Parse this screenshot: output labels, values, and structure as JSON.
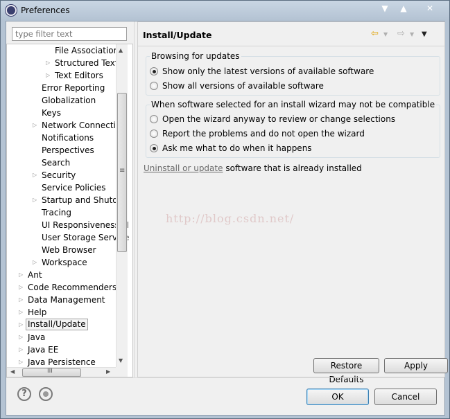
{
  "window": {
    "title": "Preferences",
    "controls": [
      "▼",
      "▲",
      "✕"
    ]
  },
  "filter": {
    "placeholder": "type filter text"
  },
  "tree": {
    "items": [
      {
        "label": "File Associations",
        "indent": 3,
        "arrow": ""
      },
      {
        "label": "Structured Text E",
        "indent": 3,
        "arrow": "▷"
      },
      {
        "label": "Text Editors",
        "indent": 3,
        "arrow": "▷"
      },
      {
        "label": "Error Reporting",
        "indent": 2,
        "arrow": ""
      },
      {
        "label": "Globalization",
        "indent": 2,
        "arrow": ""
      },
      {
        "label": "Keys",
        "indent": 2,
        "arrow": ""
      },
      {
        "label": "Network Connection",
        "indent": 2,
        "arrow": "▷"
      },
      {
        "label": "Notifications",
        "indent": 2,
        "arrow": ""
      },
      {
        "label": "Perspectives",
        "indent": 2,
        "arrow": ""
      },
      {
        "label": "Search",
        "indent": 2,
        "arrow": ""
      },
      {
        "label": "Security",
        "indent": 2,
        "arrow": "▷"
      },
      {
        "label": "Service Policies",
        "indent": 2,
        "arrow": ""
      },
      {
        "label": "Startup and Shutdov",
        "indent": 2,
        "arrow": "▷"
      },
      {
        "label": "Tracing",
        "indent": 2,
        "arrow": ""
      },
      {
        "label": "UI Responsiveness M",
        "indent": 2,
        "arrow": ""
      },
      {
        "label": "User Storage Service",
        "indent": 2,
        "arrow": ""
      },
      {
        "label": "Web Browser",
        "indent": 2,
        "arrow": ""
      },
      {
        "label": "Workspace",
        "indent": 2,
        "arrow": "▷"
      },
      {
        "label": "Ant",
        "indent": 1,
        "arrow": "▷"
      },
      {
        "label": "Code Recommenders",
        "indent": 1,
        "arrow": "▷"
      },
      {
        "label": "Data Management",
        "indent": 1,
        "arrow": "▷"
      },
      {
        "label": "Help",
        "indent": 1,
        "arrow": "▷"
      },
      {
        "label": "Install/Update",
        "indent": 1,
        "arrow": "▷",
        "selected": true
      },
      {
        "label": "Java",
        "indent": 1,
        "arrow": "▷"
      },
      {
        "label": "Java EE",
        "indent": 1,
        "arrow": "▷"
      },
      {
        "label": "Java Persistence",
        "indent": 1,
        "arrow": "▷"
      }
    ],
    "hscroll_grip": "III",
    "vscroll_grip": "≡"
  },
  "panel": {
    "title": "Install/Update",
    "back_icon": "⇦",
    "forward_icon": "⇨",
    "menu_icon": "▼",
    "groups": [
      {
        "label": "Browsing for updates",
        "options": [
          {
            "label": "Show only the latest versions of available software",
            "checked": true
          },
          {
            "label": "Show all versions of available software",
            "checked": false
          }
        ]
      },
      {
        "label": "When software selected for an install wizard may not be compatible",
        "options": [
          {
            "label": "Open the wizard anyway to review or change selections",
            "checked": false
          },
          {
            "label": "Report the problems and do not open the wizard",
            "checked": false
          },
          {
            "label": "Ask me what to do when it happens",
            "checked": true
          }
        ]
      }
    ],
    "uninstall_link": "Uninstall or update",
    "uninstall_text": " software that is already installed",
    "watermark": "http://blog.csdn.net/",
    "restore_defaults": "Restore Defaults",
    "apply": "Apply"
  },
  "footer": {
    "help_icon": "?",
    "ok": "OK",
    "cancel": "Cancel"
  }
}
